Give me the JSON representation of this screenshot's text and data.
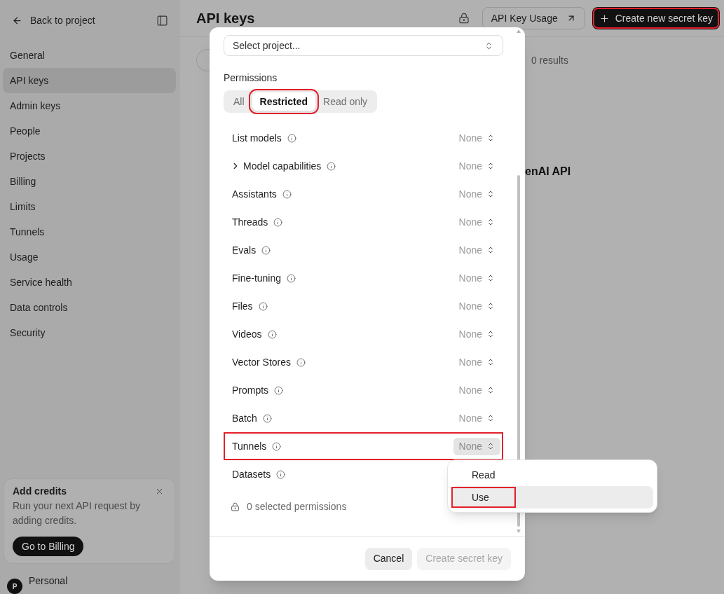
{
  "sidebar": {
    "back_link": "Back to project",
    "items": [
      {
        "label": "General",
        "selected": false
      },
      {
        "label": "API keys",
        "selected": true
      },
      {
        "label": "Admin keys",
        "selected": false
      },
      {
        "label": "People",
        "selected": false
      },
      {
        "label": "Projects",
        "selected": false
      },
      {
        "label": "Billing",
        "selected": false
      },
      {
        "label": "Limits",
        "selected": false
      },
      {
        "label": "Tunnels",
        "selected": false
      },
      {
        "label": "Usage",
        "selected": false
      },
      {
        "label": "Service health",
        "selected": false
      },
      {
        "label": "Data controls",
        "selected": false
      },
      {
        "label": "Security",
        "selected": false
      }
    ],
    "credits_card": {
      "title": "Add credits",
      "text": "Run your next API request by adding credits.",
      "button": "Go to Billing"
    },
    "account": {
      "avatar": "P",
      "name": "Personal"
    }
  },
  "header": {
    "title": "API keys",
    "buttons": [
      {
        "label": "API Key Usage",
        "kind": "outline",
        "highlighted": false
      },
      {
        "label": "Create new secret key",
        "kind": "primary",
        "highlighted": true
      }
    ]
  },
  "content": {
    "results": "0 results",
    "heading": "enAI API"
  },
  "dialog": {
    "project_select": {
      "placeholder": "Select project..."
    },
    "permissions_label": "Permissions",
    "modes": [
      {
        "label": "All",
        "selected": false,
        "highlighted": false
      },
      {
        "label": "Restricted",
        "selected": true,
        "highlighted": true
      },
      {
        "label": "Read only",
        "selected": false,
        "highlighted": false
      }
    ],
    "permissions": [
      {
        "name": "List models",
        "kind": "item",
        "value": "None",
        "open": false,
        "highlighted": false
      },
      {
        "name": "Model capabilities",
        "kind": "group",
        "expanded": false,
        "value": "None",
        "open": false,
        "highlighted": false
      },
      {
        "name": "Assistants",
        "kind": "item",
        "value": "None",
        "open": false,
        "highlighted": false
      },
      {
        "name": "Threads",
        "kind": "item",
        "value": "None",
        "open": false,
        "highlighted": false
      },
      {
        "name": "Evals",
        "kind": "item",
        "value": "None",
        "open": false,
        "highlighted": false
      },
      {
        "name": "Fine-tuning",
        "kind": "item",
        "value": "None",
        "open": false,
        "highlighted": false
      },
      {
        "name": "Files",
        "kind": "item",
        "value": "None",
        "open": false,
        "highlighted": false
      },
      {
        "name": "Videos",
        "kind": "item",
        "value": "None",
        "open": false,
        "highlighted": false
      },
      {
        "name": "Vector Stores",
        "kind": "item",
        "value": "None",
        "open": false,
        "highlighted": false
      },
      {
        "name": "Prompts",
        "kind": "item",
        "value": "None",
        "open": false,
        "highlighted": false
      },
      {
        "name": "Batch",
        "kind": "item",
        "value": "None",
        "open": false,
        "highlighted": false
      },
      {
        "name": "Tunnels",
        "kind": "item",
        "value": "None",
        "open": true,
        "highlighted": true
      },
      {
        "name": "Datasets",
        "kind": "item",
        "highlighted": false
      }
    ],
    "summary": "0 selected permissions",
    "buttons": [
      {
        "label": "Cancel",
        "disabled": false
      },
      {
        "label": "Create secret key",
        "disabled": true
      }
    ]
  },
  "menu": {
    "options": [
      {
        "label": "Read",
        "selected": false,
        "highlighted": false
      },
      {
        "label": "Use",
        "selected": true,
        "highlighted": true
      }
    ]
  }
}
